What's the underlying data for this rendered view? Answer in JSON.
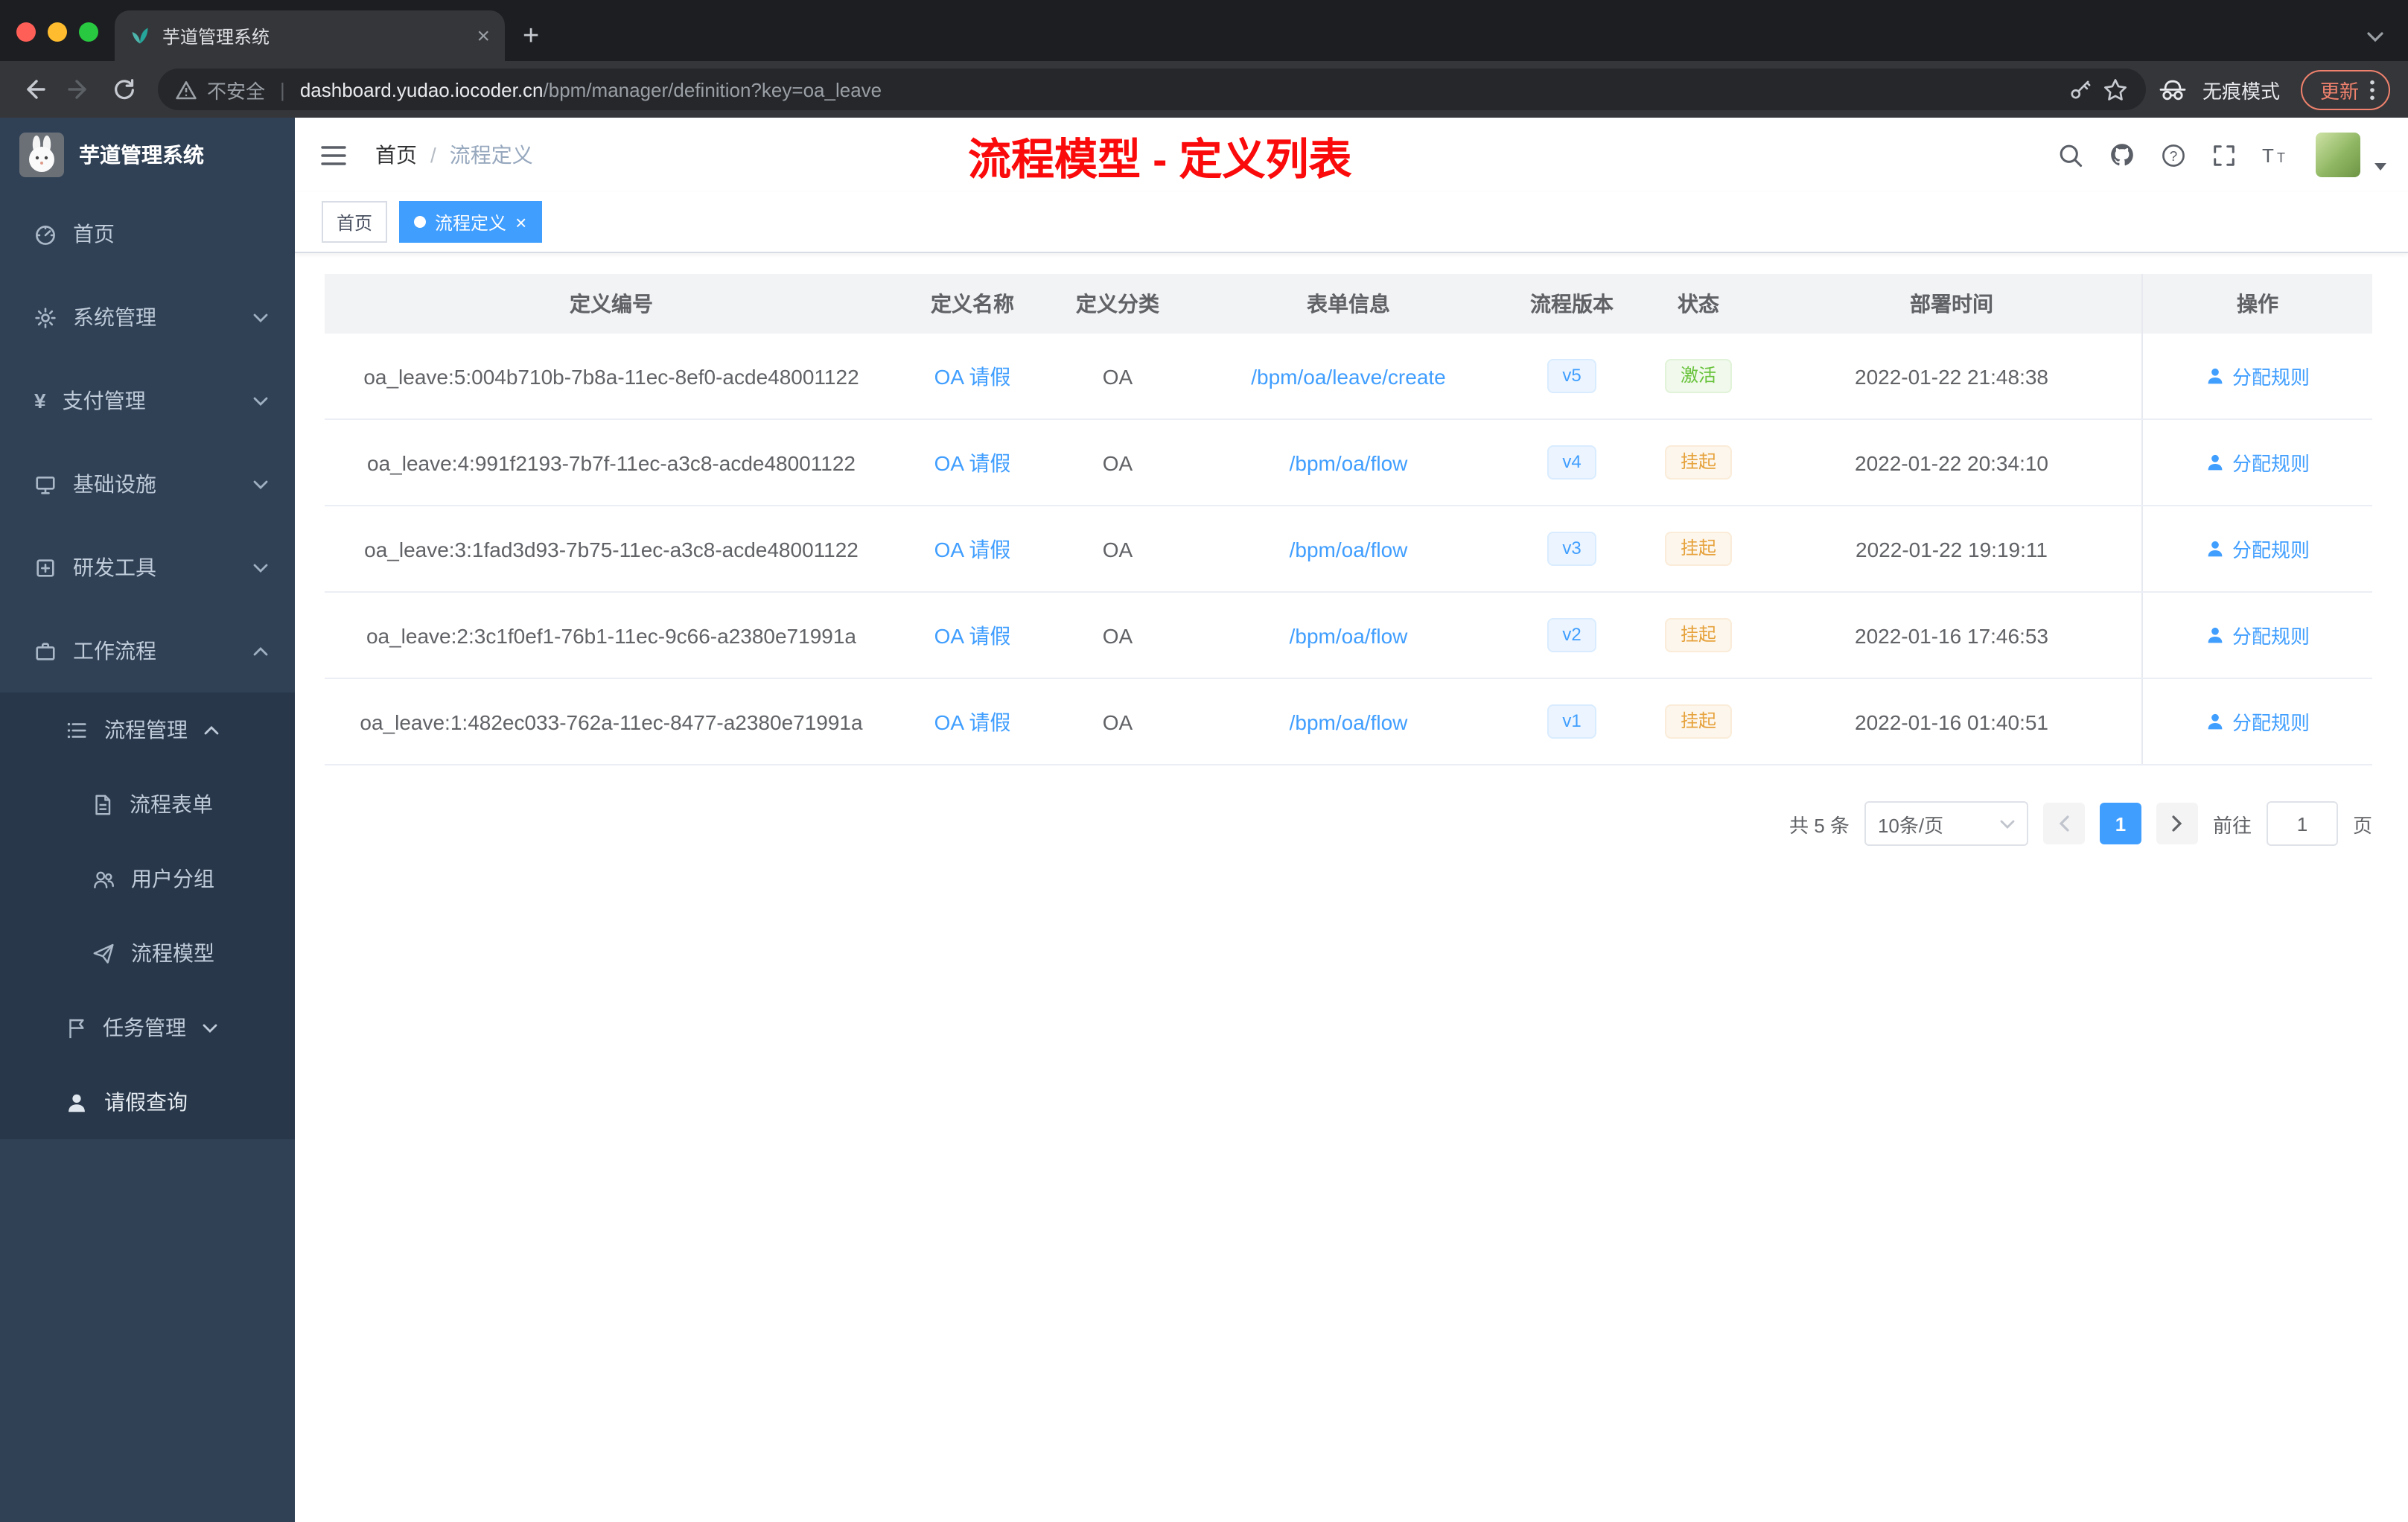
{
  "colors": {
    "accent": "#409EFF",
    "success": "#67C23A",
    "warning": "#E6A23C",
    "annotation_red": "#FA0A0A",
    "sidebar_bg": "#304156",
    "submenu_bg": "#28374A",
    "tab_version_bg": "#ECF5FF"
  },
  "browser": {
    "tab_title": "芋道管理系统",
    "security_label": "不安全",
    "url_domain": "dashboard.yudao.iocoder.cn",
    "url_path": "/bpm/manager/definition?key=oa_leave",
    "incognito_label": "无痕模式",
    "update_label": "更新"
  },
  "sidebar": {
    "logo_title": "芋道管理系统",
    "menu": {
      "home": "首页",
      "system": "系统管理",
      "payment": "支付管理",
      "infrastructure": "基础设施",
      "devtools": "研发工具",
      "workflow": "工作流程",
      "process_management": "流程管理",
      "process_form": "流程表单",
      "user_group": "用户分组",
      "process_model": "流程模型",
      "task_management": "任务管理",
      "leave_query": "请假查询"
    }
  },
  "header": {
    "breadcrumb_home": "首页",
    "breadcrumb_sep": "/",
    "breadcrumb_current": "流程定义",
    "annotation": "流程模型 - 定义列表"
  },
  "tags": {
    "home": "首页",
    "active": "流程定义",
    "close": "×"
  },
  "icons": {
    "yen": "¥",
    "close_tab": "×",
    "new_tab": "+"
  },
  "table": {
    "columns": [
      "定义编号",
      "定义名称",
      "定义分类",
      "表单信息",
      "流程版本",
      "状态",
      "部署时间",
      "操作"
    ],
    "rows": [
      {
        "id": "oa_leave:5:004b710b-7b8a-11ec-8ef0-acde48001122",
        "name": "OA 请假",
        "category": "OA",
        "form": "/bpm/oa/leave/create",
        "version": "v5",
        "status": "激活",
        "deploy_time": "2022-01-22 21:48:38",
        "action": "分配规则"
      },
      {
        "id": "oa_leave:4:991f2193-7b7f-11ec-a3c8-acde48001122",
        "name": "OA 请假",
        "category": "OA",
        "form": "/bpm/oa/flow",
        "version": "v4",
        "status": "挂起",
        "deploy_time": "2022-01-22 20:34:10",
        "action": "分配规则"
      },
      {
        "id": "oa_leave:3:1fad3d93-7b75-11ec-a3c8-acde48001122",
        "name": "OA 请假",
        "category": "OA",
        "form": "/bpm/oa/flow",
        "version": "v3",
        "status": "挂起",
        "deploy_time": "2022-01-22 19:19:11",
        "action": "分配规则"
      },
      {
        "id": "oa_leave:2:3c1f0ef1-76b1-11ec-9c66-a2380e71991a",
        "name": "OA 请假",
        "category": "OA",
        "form": "/bpm/oa/flow",
        "version": "v2",
        "status": "挂起",
        "deploy_time": "2022-01-16 17:46:53",
        "action": "分配规则"
      },
      {
        "id": "oa_leave:1:482ec033-762a-11ec-8477-a2380e71991a",
        "name": "OA 请假",
        "category": "OA",
        "form": "/bpm/oa/flow",
        "version": "v1",
        "status": "挂起",
        "deploy_time": "2022-01-16 01:40:51",
        "action": "分配规则"
      }
    ]
  },
  "pagination": {
    "total": "共 5 条",
    "page_size": "10条/页",
    "current_page": "1",
    "goto_label": "前往",
    "goto_value": "1",
    "goto_unit": "页"
  }
}
